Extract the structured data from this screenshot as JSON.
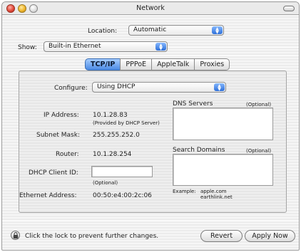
{
  "window": {
    "title": "Network"
  },
  "location": {
    "label": "Location:",
    "value": "Automatic"
  },
  "show": {
    "label": "Show:",
    "value": "Built-in Ethernet"
  },
  "tabs": [
    {
      "label": "TCP/IP",
      "active": true
    },
    {
      "label": "PPPoE",
      "active": false
    },
    {
      "label": "AppleTalk",
      "active": false
    },
    {
      "label": "Proxies",
      "active": false
    }
  ],
  "tcpip": {
    "configure_label": "Configure:",
    "configure_value": "Using DHCP",
    "ip_label": "IP Address:",
    "ip_value": "10.1.28.83",
    "ip_note": "(Provided by DHCP Server)",
    "subnet_label": "Subnet Mask:",
    "subnet_value": "255.255.252.0",
    "router_label": "Router:",
    "router_value": "10.1.28.254",
    "dhcp_client_label": "DHCP Client ID:",
    "dhcp_client_value": "",
    "dhcp_client_note": "(Optional)",
    "ethernet_label": "Ethernet Address:",
    "ethernet_value": "00:50:e4:00:2c:06",
    "dns_label": "DNS Servers",
    "dns_optional": "(Optional)",
    "search_label": "Search Domains",
    "search_optional": "(Optional)",
    "example_label": "Example:",
    "example_line1": "apple.com",
    "example_line2": "earthlink.net"
  },
  "footer": {
    "lock_text": "Click the lock to prevent further changes.",
    "revert_label": "Revert",
    "apply_label": "Apply Now"
  },
  "colors": {
    "accent": "#4a8ae4",
    "close": "#e24a3a",
    "minimize": "#f0b52a"
  },
  "icons": [
    "close-icon",
    "minimize-icon",
    "zoom-icon",
    "toolbar-toggle-icon",
    "popup-arrows-icon",
    "lock-icon"
  ]
}
